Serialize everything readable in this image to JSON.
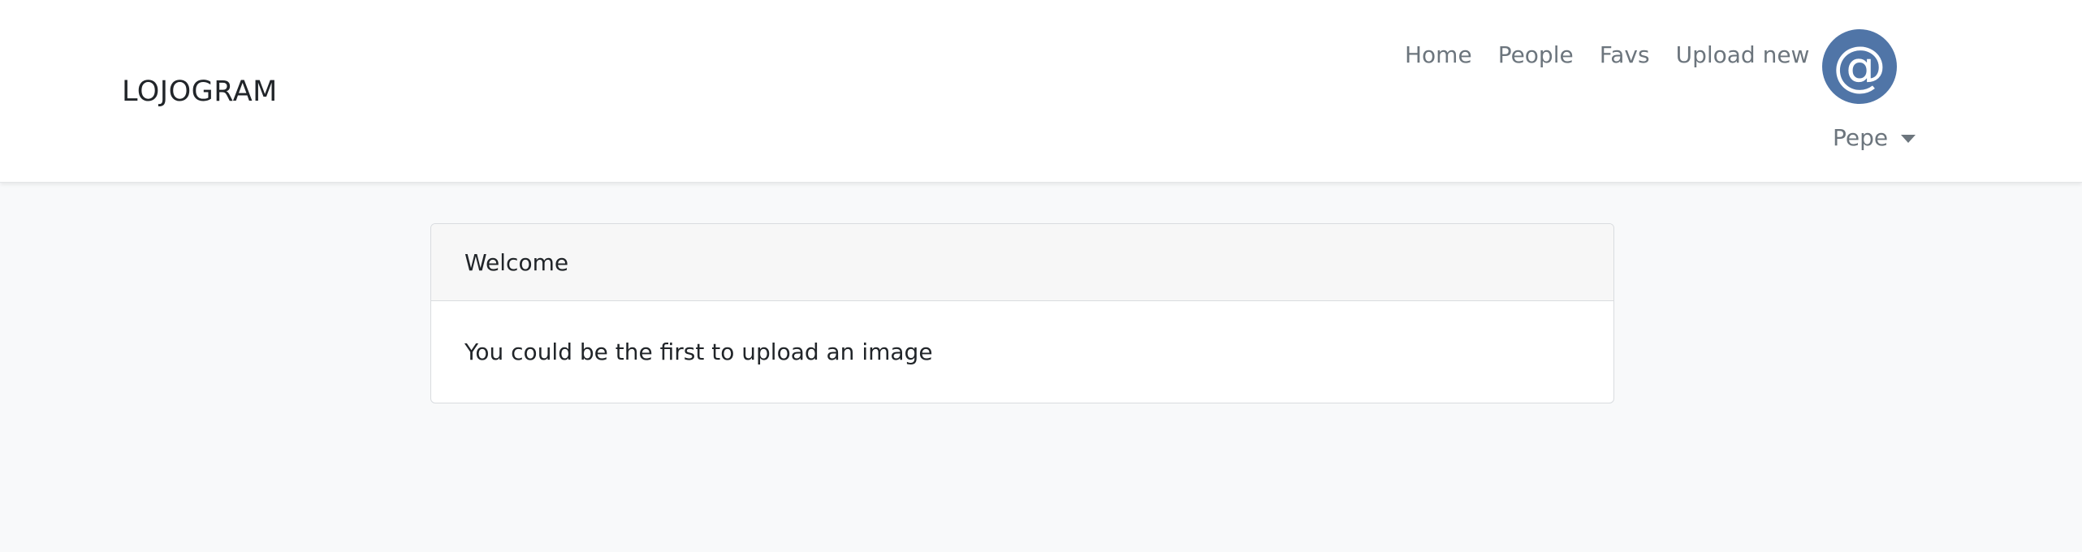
{
  "brand": "LOJOGRAM",
  "nav": {
    "links": [
      "Home",
      "People",
      "Favs",
      "Upload new"
    ],
    "avatar_glyph": "@",
    "avatar_color": "#5075a7",
    "user_name": "Pepe"
  },
  "card": {
    "header": "Welcome",
    "body": "You could be the first to upload an image"
  }
}
